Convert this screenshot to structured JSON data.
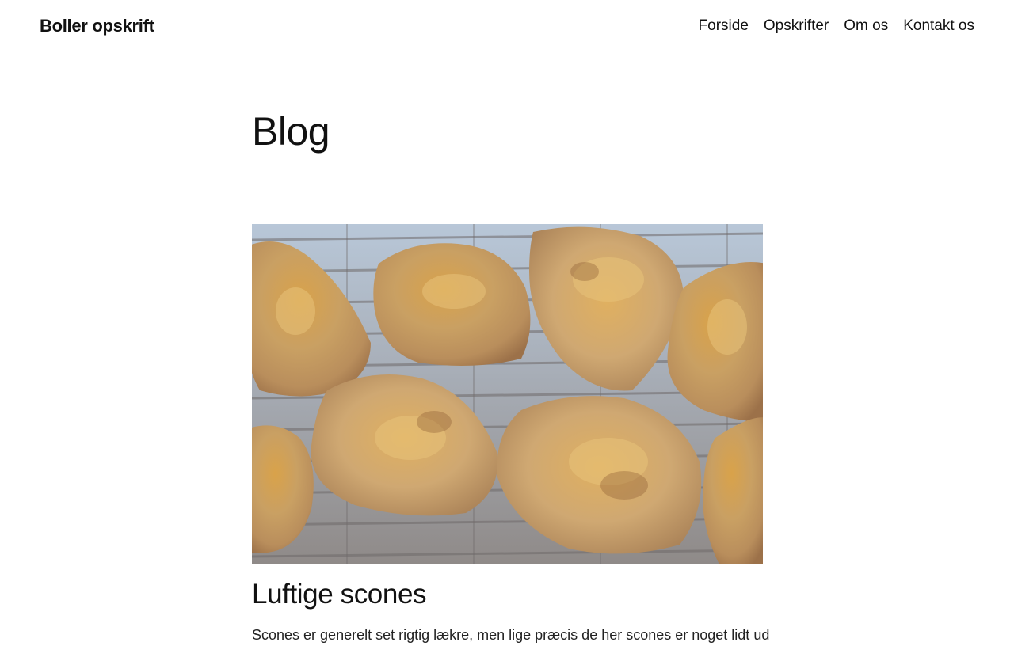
{
  "header": {
    "site_title": "Boller opskrift",
    "nav": {
      "home": "Forside",
      "recipes": "Opskrifter",
      "about": "Om os",
      "contact": "Kontakt os"
    }
  },
  "main": {
    "page_title": "Blog",
    "posts": [
      {
        "title": "Luftige scones",
        "excerpt": "Scones er generelt set rigtig lækre, men lige præcis de her scones er noget lidt ud"
      }
    ]
  },
  "colors": {
    "text": "#111111",
    "background": "#ffffff"
  }
}
